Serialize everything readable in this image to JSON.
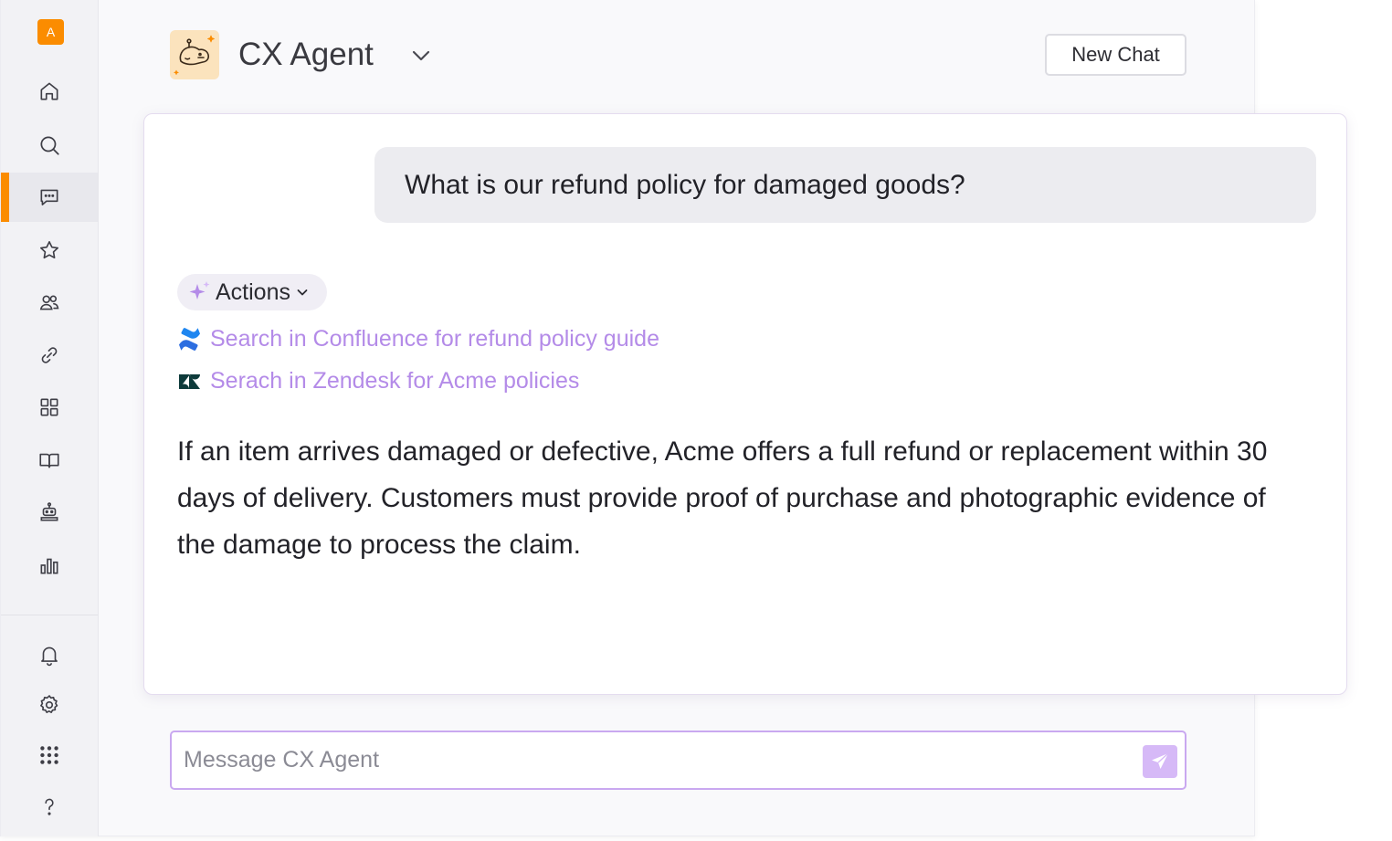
{
  "sidebar": {
    "avatar_initial": "A",
    "nav_icons": [
      "home-icon",
      "search-icon",
      "chat-icon",
      "star-icon",
      "users-icon",
      "link-icon",
      "grid-icon",
      "book-icon",
      "robot-icon",
      "chart-icon"
    ],
    "bottom_icons": [
      "bell-icon",
      "gear-icon",
      "apps-icon",
      "help-icon"
    ],
    "active_item": "chat-icon",
    "accent_color": "#fb8c00"
  },
  "header": {
    "agent_name": "CX Agent",
    "new_chat_label": "New Chat"
  },
  "chat": {
    "user_message": "What is our refund policy for damaged goods?",
    "actions_label": "Actions",
    "actions": [
      {
        "icon": "confluence-icon",
        "label": "Search in Confluence for refund policy guide"
      },
      {
        "icon": "zendesk-icon",
        "label": "Serach in Zendesk for Acme policies"
      }
    ],
    "answer": "If an item arrives damaged or defective, Acme offers a full refund or replacement within 30 days of delivery. Customers must provide proof of purchase and photographic evidence of the damage to process the claim."
  },
  "composer": {
    "placeholder": "Message CX Agent",
    "value": ""
  },
  "colors": {
    "link": "#b48be8",
    "input_border": "#c9a8f0",
    "send_button": "#d6b9f7"
  }
}
